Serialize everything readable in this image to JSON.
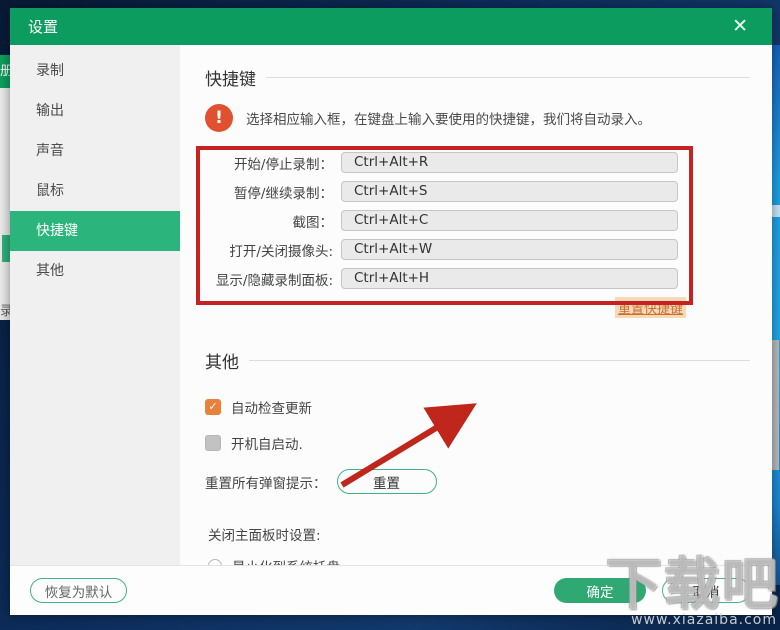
{
  "window": {
    "title": "设置",
    "close_icon": "✕"
  },
  "background": {
    "left_edge_glyph_top": "册",
    "left_edge_glyph_bottom": "录"
  },
  "sidebar": {
    "items": [
      {
        "label": "录制"
      },
      {
        "label": "输出"
      },
      {
        "label": "声音"
      },
      {
        "label": "鼠标"
      },
      {
        "label": "快捷键"
      },
      {
        "label": "其他"
      }
    ],
    "selected": "快捷键"
  },
  "hotkeys_section": {
    "title": "快捷键",
    "warning_icon": "!",
    "notice": "选择相应输入框，在键盘上输入要使用的快捷键，我们将自动录入。",
    "rows": [
      {
        "label": "开始/停止录制：",
        "value": "Ctrl+Alt+R"
      },
      {
        "label": "暂停/继续录制：",
        "value": "Ctrl+Alt+S"
      },
      {
        "label": "截图：",
        "value": "Ctrl+Alt+C"
      },
      {
        "label": "打开/关闭摄像头:",
        "value": "Ctrl+Alt+W"
      },
      {
        "label": "显示/隐藏录制面板:",
        "value": "Ctrl+Alt+H"
      }
    ],
    "reset_link": "重置快捷键"
  },
  "other_section": {
    "title": "其他",
    "checkboxes": [
      {
        "label": "自动检查更新",
        "checked": true,
        "check_glyph": "✓"
      },
      {
        "label": "开机自启动.",
        "checked": false,
        "check_glyph": ""
      }
    ],
    "reset_all_label": "重置所有弹窗提示：",
    "reset_button": "重置",
    "close_panel_label": "关闭主面板时设置:",
    "radio_option": "最小化到系统托盘"
  },
  "footer": {
    "restore_defaults": "恢复为默认",
    "ok": "确定",
    "cancel": "取消"
  },
  "watermark": {
    "text": "下载吧",
    "url": "www.xiazaiba.com"
  },
  "colors": {
    "titlebar_green": "#0d9c5f",
    "selected_green": "#2cb47d",
    "button_green": "#2fa873",
    "warning_orange": "#e0512f",
    "checkbox_orange": "#e8813b",
    "annotation_red": "#c62222",
    "link_orange": "#c96f2f"
  }
}
